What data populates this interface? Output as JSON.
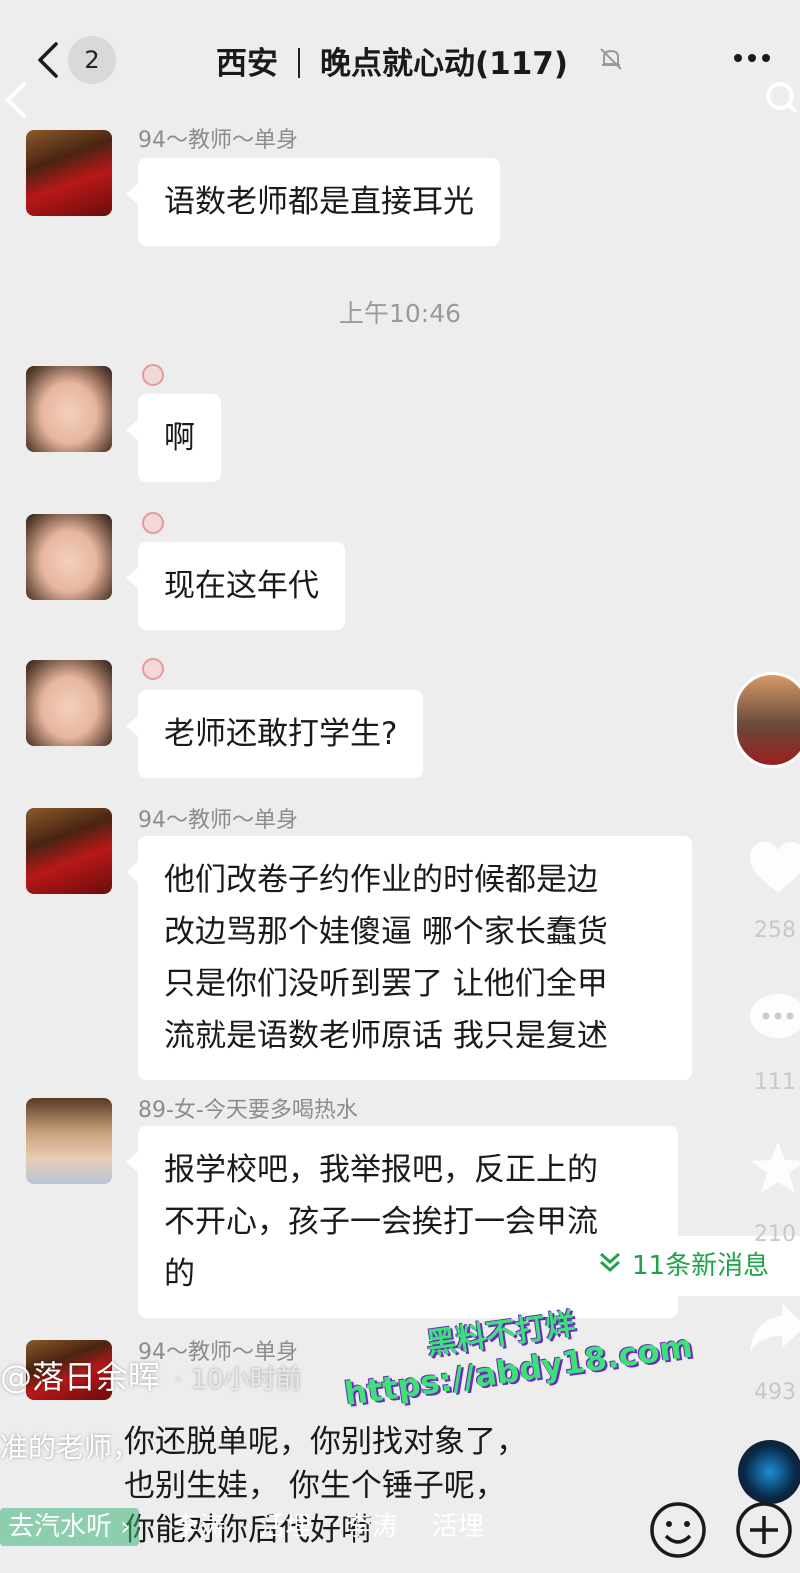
{
  "header": {
    "unread_count": "2",
    "title_location": "西安",
    "title_group": "晚点就心动(117)"
  },
  "messages": [
    {
      "sender": "94～教师～单身",
      "lines": [
        "语数老师都是直接耳光"
      ]
    },
    {
      "sender": "",
      "lines": [
        "啊"
      ]
    },
    {
      "sender": "",
      "lines": [
        "现在这年代"
      ]
    },
    {
      "sender": "",
      "lines": [
        "老师还敢打学生?"
      ]
    },
    {
      "sender": "94～教师～单身",
      "lines": [
        "他们改卷子约作业的时候都是边",
        "改边骂那个娃傻逼 哪个家长蠢货",
        "只是你们没听到罢了 让他们全甲",
        "流就是语数老师原话 我只是复述"
      ]
    },
    {
      "sender": "89-女-今天要多喝热水",
      "lines": [
        "报学校吧，我举报吧，反正上的",
        "不开心，孩子一会挨打一会甲流",
        "的"
      ]
    },
    {
      "sender": "94～教师～单身",
      "lines": []
    }
  ],
  "timestamp": "上午10:46",
  "new_messages": "11条新消息",
  "side": {
    "like_count": "258",
    "comment_count": "111",
    "favorite_count": "210",
    "share_count": "493"
  },
  "author": {
    "name": "@落日余晖",
    "time": "· 10小时前"
  },
  "caption": {
    "prefix": "准的老师，",
    "lines": [
      "你还脱单呢，你别找对象了，",
      "也别生娃， 你生个锤子呢，",
      "你能对你后代好嗬"
    ]
  },
  "music": {
    "prefix": "去汽水听 ›",
    "items": [
      "李涛",
      "活埋",
      "李涛",
      "活埋"
    ]
  },
  "watermark": {
    "line1": "黑料不打烊",
    "line2": "https://abdy18.com"
  }
}
